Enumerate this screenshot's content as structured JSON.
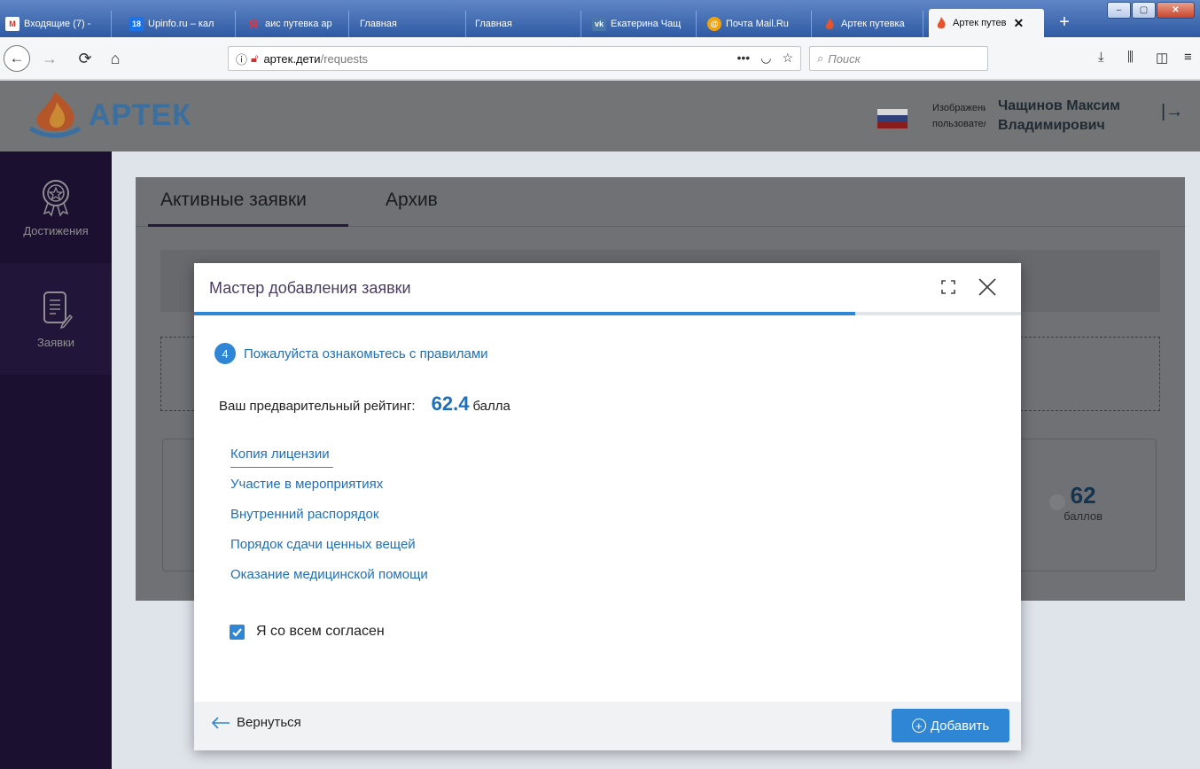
{
  "browser": {
    "tabs": [
      {
        "title": "Входящие (7) -",
        "icon": "gmail-icon",
        "icon_text": "M",
        "icon_color": "#d93025"
      },
      {
        "title": "Upinfo.ru – кал",
        "icon": "calendar-icon",
        "icon_text": "18",
        "icon_color": "#1a73e8"
      },
      {
        "title": "аис путевка ар",
        "icon": "yandex-icon",
        "icon_text": "Я",
        "icon_color": "#ff0000"
      },
      {
        "title": "Главная",
        "icon": "",
        "icon_text": "",
        "icon_color": ""
      },
      {
        "title": "Главная",
        "icon": "",
        "icon_text": "",
        "icon_color": ""
      },
      {
        "title": "Екатерина Чащ",
        "icon": "vk-icon",
        "icon_text": "vk",
        "icon_color": "#4a76a8"
      },
      {
        "title": "Почта Mail.Ru",
        "icon": "mailru-icon",
        "icon_text": "@",
        "icon_color": "#168de2"
      },
      {
        "title": "Артек путевка",
        "icon": "artek-flame-icon",
        "icon_text": "",
        "icon_color": "#e8542a"
      },
      {
        "title": "Артек путев",
        "icon": "artek-flame-icon",
        "icon_text": "",
        "icon_color": "#e8542a",
        "active": true
      }
    ],
    "url_host": "артек.дети",
    "url_path": "/requests",
    "search_placeholder": "Поиск"
  },
  "header": {
    "logo_text": "АРТЕК",
    "avatar_alt": "Изображение пользователя",
    "user_name_line1": "Чащинов Максим",
    "user_name_line2": "Владимирович"
  },
  "sidebar": {
    "items": [
      {
        "label": "Достижения",
        "icon": "achievement-badge-icon"
      },
      {
        "label": "Заявки",
        "icon": "document-edit-icon",
        "active": true
      }
    ]
  },
  "page": {
    "tabs": [
      {
        "label": "Активные заявки",
        "active": true
      },
      {
        "label": "Архив"
      }
    ],
    "card_score": "62",
    "card_score_unit": "баллов"
  },
  "modal": {
    "title": "Мастер добавления заявки",
    "progress": 0.8,
    "step_number": "4",
    "step_label": "Пожалуйста ознакомьтесь с правилами",
    "rating_label": "Ваш предварительный рейтинг:",
    "rating_value": "62.4",
    "rating_unit": "балла",
    "rule_links": [
      "Копия лицензии",
      "Участие в мероприятиях",
      "Внутренний распорядок",
      "Порядок сдачи ценных вещей",
      "Оказание медицинской помощи"
    ],
    "agree_label": "Я со всем согласен",
    "agree_checked": true,
    "back_label": "Вернуться",
    "add_label": "Добавить"
  },
  "colors": {
    "accent": "#2e86d4",
    "sidebar_bg": "#1c1030",
    "title_purple": "#4a3d63"
  }
}
